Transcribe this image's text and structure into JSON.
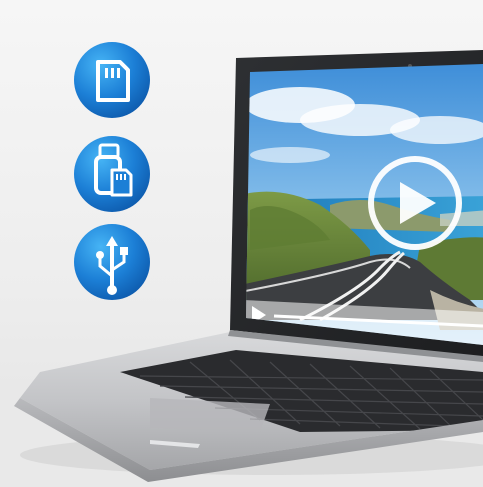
{
  "scene": {
    "description_icons": [
      "sd-card-icon",
      "usb-drive-with-microsd-icon",
      "usb-symbol-icon"
    ],
    "media": {
      "play_button": "play-icon",
      "playback_progress": 0.0
    },
    "colors": {
      "background_top": "#f3f3f3",
      "background_bottom": "#e6e6e6",
      "icon_blue_light": "#35a4ee",
      "icon_blue_dark": "#0d5fb8",
      "laptop_silver": "#c8c9cb",
      "laptop_dark": "#2a2b2e",
      "sky": "#5fa6e0",
      "sea": "#2f8fc9",
      "road": "#3c3e41"
    }
  }
}
